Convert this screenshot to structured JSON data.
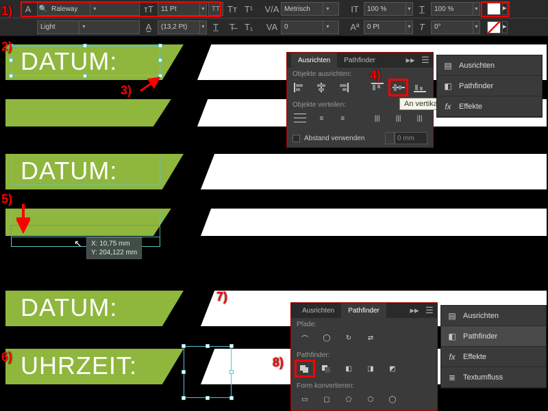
{
  "toolbar": {
    "font_family": "Raleway",
    "font_size": "11 Pt",
    "caps_label": "TT",
    "kerning_mode": "Metrisch",
    "hscale": "100 %",
    "vscale": "100 %",
    "font_weight": "Light",
    "leading": "(13,2 Pt)",
    "tracking": "0",
    "baseline": "0 Pt",
    "skew": "0°"
  },
  "annotations": {
    "a1": "1)",
    "a2": "2)",
    "a3": "3)",
    "a4": "4)",
    "a5": "5)",
    "a6": "6)",
    "a7": "7)",
    "a8": "8)"
  },
  "banners": {
    "datum": "DATUM:",
    "uhrzeit": "UHRZEIT:"
  },
  "coords": {
    "x": "X: 10,75 mm",
    "y": "Y: 204,122 mm"
  },
  "align_panel": {
    "tab_align": "Ausrichten",
    "tab_pathfinder": "Pathfinder",
    "sec_align": "Objekte ausrichten:",
    "sec_distribute": "Objekte verteilen:",
    "use_gap": "Abstand verwenden",
    "gap_value": "0 mm",
    "tooltip": "An vertikaler Mittelachse ausricht"
  },
  "pathfinder_panel": {
    "tab_align": "Ausrichten",
    "tab_pathfinder": "Pathfinder",
    "sec_paths": "Pfade:",
    "sec_pf": "Pathfinder:",
    "sec_convert": "Form konvertieren:"
  },
  "side1": {
    "align": "Ausrichten",
    "pathfinder": "Pathfinder",
    "effects": "Effekte"
  },
  "side2": {
    "align": "Ausrichten",
    "pathfinder": "Pathfinder",
    "effects": "Effekte",
    "textwrap": "Textumfluss"
  }
}
